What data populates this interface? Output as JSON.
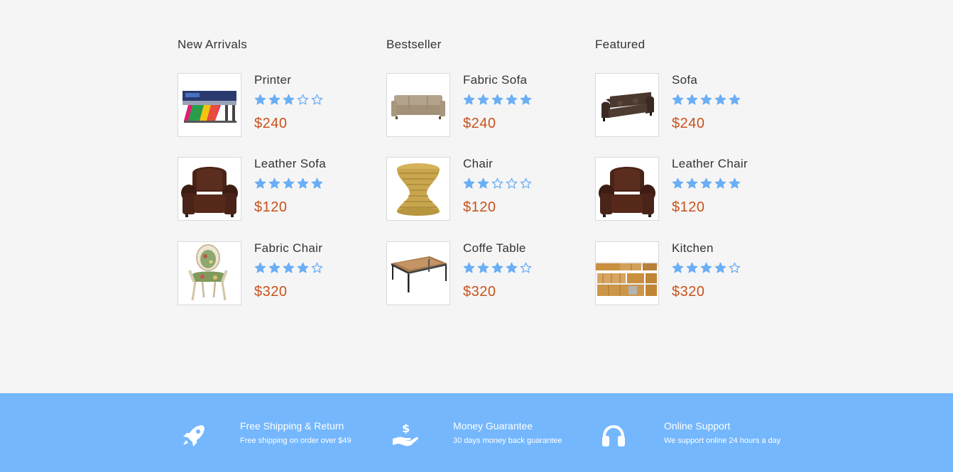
{
  "columns": [
    {
      "title": "New Arrivals",
      "products": [
        {
          "name": "Printer",
          "rating": 3,
          "price": "$240",
          "image": "printer"
        },
        {
          "name": "Leather Sofa",
          "rating": 5,
          "price": "$120",
          "image": "leather-armchair"
        },
        {
          "name": "Fabric Chair",
          "rating": 4,
          "price": "$320",
          "image": "fabric-chair"
        }
      ]
    },
    {
      "title": "Bestseller",
      "products": [
        {
          "name": "Fabric Sofa",
          "rating": 5,
          "price": "$240",
          "image": "fabric-sofa"
        },
        {
          "name": "Chair",
          "rating": 2,
          "price": "$120",
          "image": "rattan-stool"
        },
        {
          "name": "Coffe Table",
          "rating": 4,
          "price": "$320",
          "image": "coffee-table"
        }
      ]
    },
    {
      "title": "Featured",
      "products": [
        {
          "name": "Sofa",
          "rating": 5,
          "price": "$240",
          "image": "dark-sofa"
        },
        {
          "name": "Leather Chair",
          "rating": 5,
          "price": "$120",
          "image": "leather-armchair"
        },
        {
          "name": "Kitchen",
          "rating": 4,
          "price": "$320",
          "image": "kitchen"
        }
      ]
    }
  ],
  "max_rating": 5,
  "features": [
    {
      "icon": "rocket-icon",
      "title": "Free Shipping & Return",
      "subtitle": "Free shipping on order over $49"
    },
    {
      "icon": "money-hand-icon",
      "title": "Money Guarantee",
      "subtitle": "30 days money back guarantee"
    },
    {
      "icon": "headphones-icon",
      "title": "Online Support",
      "subtitle": "We support online 24 hours a day"
    }
  ],
  "colors": {
    "background": "#f5f5f5",
    "star": "#6aaef5",
    "price": "#c8511b",
    "footer": "#74b7fd"
  }
}
